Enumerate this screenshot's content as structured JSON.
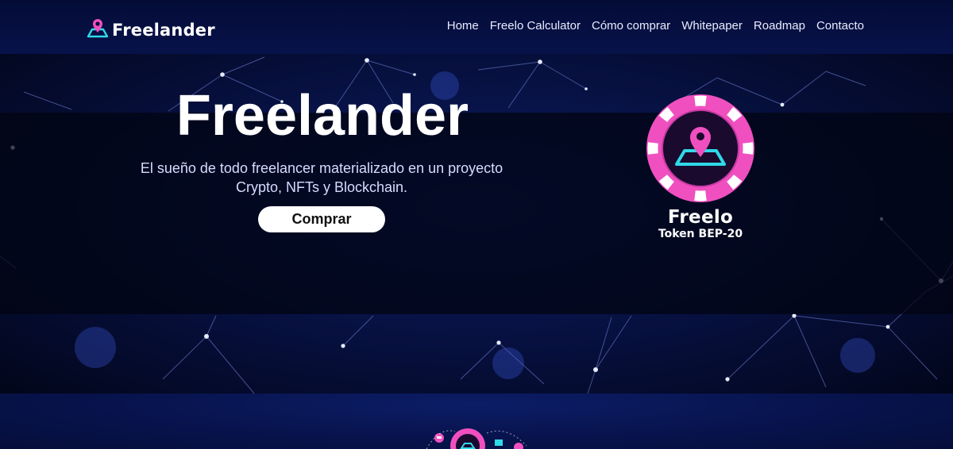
{
  "brand": {
    "name": "Freelander",
    "icon": "map-pin-icon"
  },
  "nav": {
    "items": [
      {
        "label": "Home"
      },
      {
        "label": "Freelo Calculator"
      },
      {
        "label": "Cómo comprar"
      },
      {
        "label": "Whitepaper"
      },
      {
        "label": "Roadmap"
      },
      {
        "label": "Contacto"
      }
    ]
  },
  "hero": {
    "title": "Freelander",
    "subtitle_line1": "El sueño de todo freelancer materializado en un proyecto",
    "subtitle_line2": "Crypto, NFTs y Blockchain.",
    "button_label": "Comprar"
  },
  "token": {
    "name": "Freelo",
    "type": "Token BEP-20",
    "icon": "freelo-coin-icon"
  },
  "colors": {
    "accent_pink": "#f04fc0",
    "accent_cyan": "#2fd9e8",
    "nav_bg": "#050d3a",
    "text_light": "#e8ecff"
  }
}
